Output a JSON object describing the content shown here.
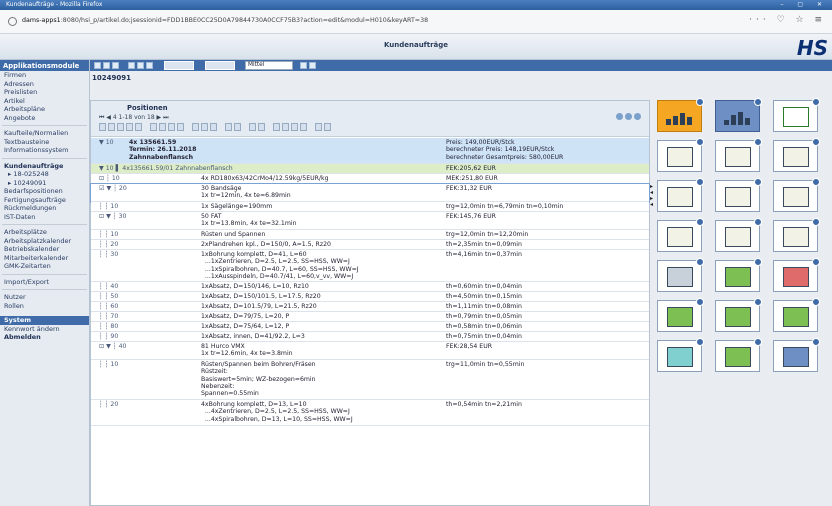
{
  "window": {
    "title": "Kundenaufträge - Mozilla Firefox"
  },
  "browser": {
    "url_host": "dams-apps1",
    "url_rest": ":8080/hsi_p/artikel.do;jsessionid=FDD1BBE0CC25D0A79844730A0CCF75B3?action=edit&modul=H010&keyART=38",
    "icons": "··· ♡ ☆ ≡"
  },
  "app": {
    "title": "Kundenaufträge",
    "logo": "HS"
  },
  "sidebar": {
    "header": "Applikationsmodule",
    "group1": [
      "Firmen",
      "Adressen",
      "Preislisten",
      "Artikel",
      "Arbeitspläne",
      "Angebote"
    ],
    "group2": [
      "Kaufteile/Normalien",
      "Textbausteine",
      "Informationssystem"
    ],
    "group3_title": "Kundenaufträge",
    "group3_sub": [
      "▸ 18-025248",
      "▸ 10249091"
    ],
    "group3": [
      "Bedarfspositionen",
      "Fertigungsaufträge",
      "Rückmeldungen",
      "IST-Daten"
    ],
    "group4": [
      "Arbeitsplätze",
      "Arbeitsplatzkalender",
      "Betriebskalender",
      "Mitarbeiterkalender",
      "GMK-Zeitarten"
    ],
    "group5": [
      "Import/Export"
    ],
    "group6": [
      "Nutzer",
      "Rollen"
    ],
    "system": "System",
    "system_items": [
      "Kennwort ändern",
      "Abmelden"
    ]
  },
  "toolbar": {
    "select_label": "Mittel"
  },
  "doc_id": "10249091",
  "positions": {
    "title": "Positionen",
    "nav": "⏮ ◀ 4  1-18 von 18  ▶ ⏭",
    "rows": [
      {
        "c1": "▼ 10",
        "c2": "4x 135661.59\nTermin: 26.11.2018\nZahnnabenflansch",
        "c3": "Preis: 149,00EUR/Stck\nberechneter Preis: 148,19EUR/Stck\nberechneter Gesamtpreis: 580,00EUR"
      },
      {
        "c1": "▼     10 ▌ 4x135661.59/01 Zahnnabenflansch",
        "c2": "",
        "c3": "FEK:205,62 EUR"
      },
      {
        "c1": "⊡   ┆   10",
        "c2": "4x RD180x63/42CrMo4/12.59kg/5EUR/kg",
        "c3": "MEK:251,80 EUR"
      },
      {
        "c1": "☑ ▼ ┆ 20",
        "c2": "30 Bandsäge\n1x tr=12min, 4x te=6.89min",
        "c3": "FEK:31,32 EUR"
      },
      {
        "c1": "┆   ┆   10",
        "c2": "1x Sägelänge=190mm",
        "c3": "trg=12,0min tn=6,79min tn=0,10min"
      },
      {
        "c1": "⊡ ▼ ┆ 30",
        "c2": "50 FAT\n1x tr=13.8min, 4x te=32.1min",
        "c3": "FEK:145,76 EUR"
      },
      {
        "c1": "┆   ┆   10",
        "c2": "Rüsten und Spannen",
        "c3": "trg=12,0min tn=12,20min"
      },
      {
        "c1": "┆   ┆   20",
        "c2": "2xPlandrehen kpl., D=150/0, A=1.5, Rz20",
        "c3": "th=2,35min tn=0,09min"
      },
      {
        "c1": "┆   ┆   30",
        "c2": "1xBohrung komplett, D=41, L=60\n  ...1xZentrieren, D=2.5, L=2.5, SS=HSS, WW=J\n  ...1xSpiralbohren, D=40.7, L=60, SS=HSS, WW=J\n  ...1xAusspindeln, D=40.7/41, L=60,v_vv, WW=J",
        "c3": "th=4,16min tn=0,37min"
      },
      {
        "c1": "┆   ┆   40",
        "c2": "1xAbsatz, D=150/146, L=10, Rz10",
        "c3": "th=0,60min tn=0,04min"
      },
      {
        "c1": "┆   ┆   50",
        "c2": "1xAbsatz, D=150/101.5, L=17.5, Rz20",
        "c3": "th=4,50min tn=0,15min"
      },
      {
        "c1": "┆   ┆   60",
        "c2": "1xAbsatz, D=101.5/79, L=21.5, Rz20",
        "c3": "th=1,11min tn=0,08min"
      },
      {
        "c1": "┆   ┆   70",
        "c2": "1xAbsatz, D=79/75, L=20, P",
        "c3": "th=0,79min tn=0,05min"
      },
      {
        "c1": "┆   ┆   80",
        "c2": "1xAbsatz, D=75/64, L=12, P",
        "c3": "th=0,58min tn=0,06min"
      },
      {
        "c1": "┆   ┆   90",
        "c2": "1xAbsatz, innen, D=41/92.2, L=3",
        "c3": "th=0,75min tn=0,04min"
      },
      {
        "c1": "⊡ ▼ ┆ 40",
        "c2": "81 Hurco VMX\n1x tr=12.6min, 4x te=3.8min",
        "c3": "FEK:28,54 EUR"
      },
      {
        "c1": "┆   ┆   10",
        "c2": "Rüsten/Spannen beim Bohren/Fräsen\nRüstzeit:\nBasiswert=5min; WZ-bezogen=6min\nNebenzeit:\nSpannen=0.55min",
        "c3": "trg=11,0min tn=0,55min"
      },
      {
        "c1": "┆   ┆   20",
        "c2": "4xBohrung komplett, D=13, L=10\n  ...4xZentrieren, D=2.5, L=2.5, SS=HSS, WW=J\n  ...4xSpiralbohren, D=13, L=10, SS=HSS, WW=J",
        "c3": "th=0,54min tn=2,21min"
      }
    ]
  }
}
